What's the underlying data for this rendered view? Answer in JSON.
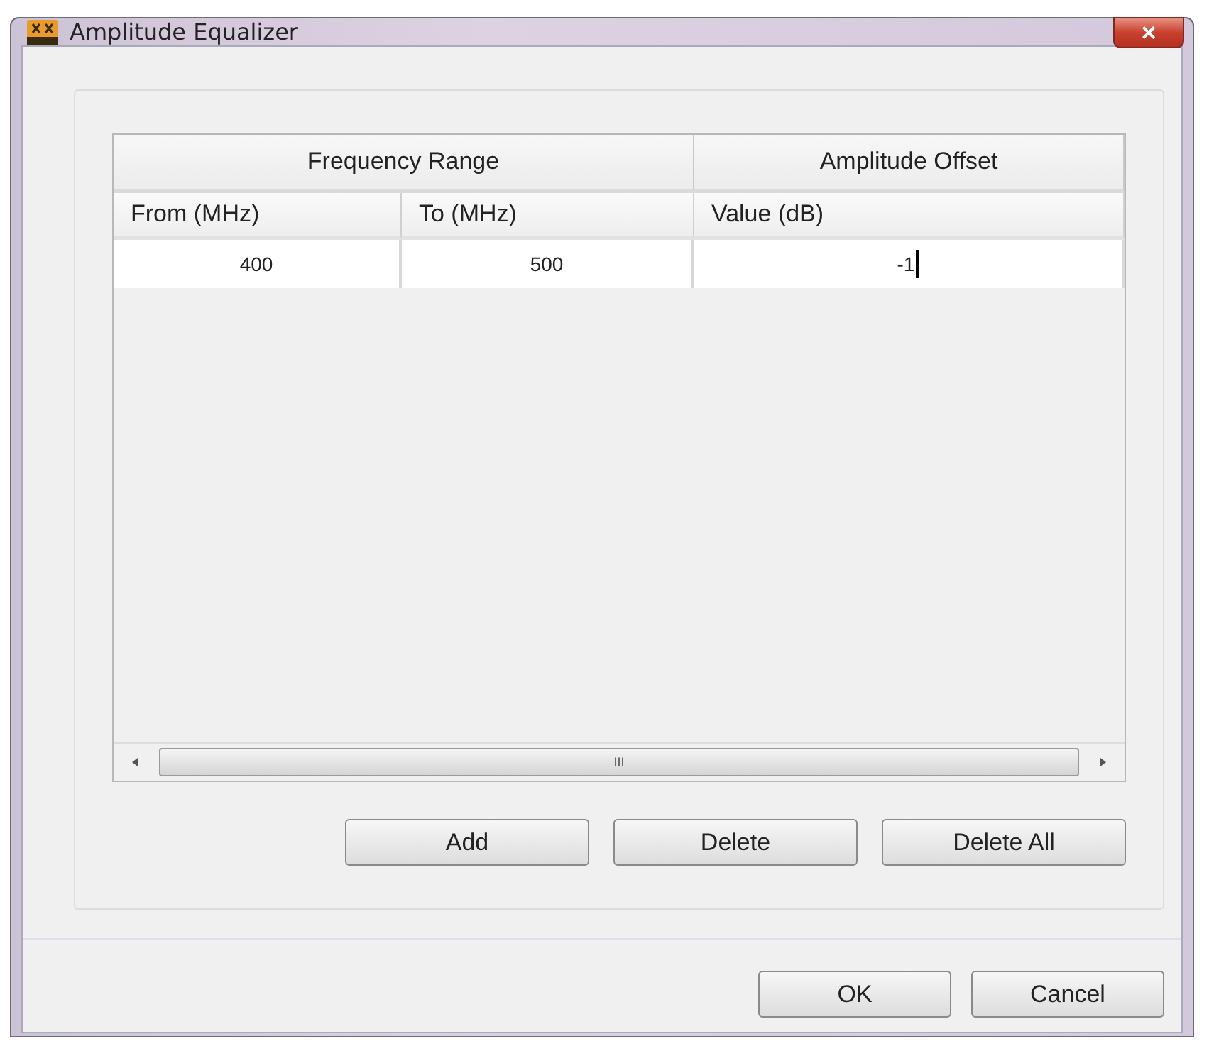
{
  "window": {
    "title": "Amplitude Equalizer",
    "close_label": "×"
  },
  "table": {
    "group_headers": [
      {
        "label": "Frequency Range"
      },
      {
        "label": "Amplitude Offset"
      }
    ],
    "columns": [
      "From (MHz)",
      "To (MHz)",
      "Value (dB)"
    ],
    "rows": [
      {
        "cells": [
          {
            "text": "400",
            "editing": false
          },
          {
            "text": "500",
            "editing": false
          },
          {
            "text": "-1",
            "editing": true
          }
        ]
      }
    ],
    "scrollbar_grip": "III"
  },
  "table_buttons": [
    "Add",
    "Delete",
    "Delete All"
  ],
  "dialog_buttons": [
    "OK",
    "Cancel"
  ]
}
